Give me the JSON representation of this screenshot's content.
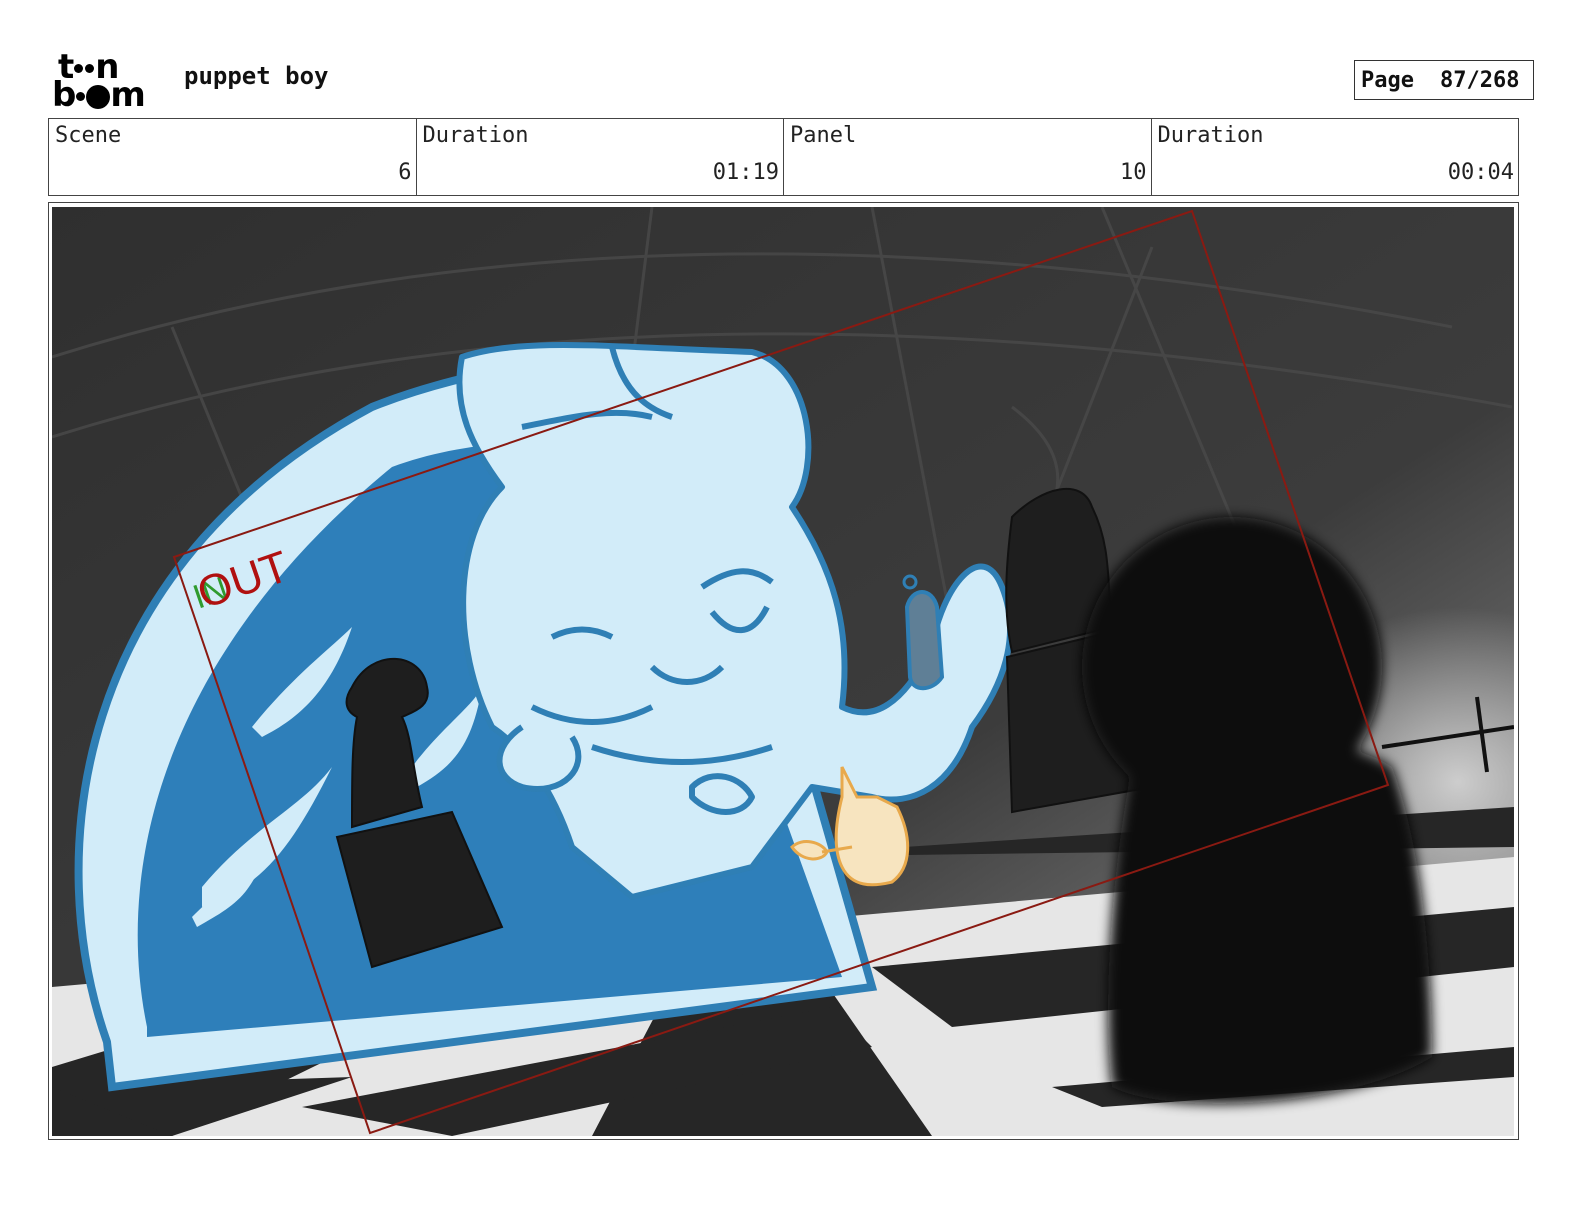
{
  "header": {
    "logo_text_top": "toon",
    "logo_text_bottom": "boom",
    "project_title": "puppet boy",
    "page_label": "Page",
    "page_value": "87/268"
  },
  "info": {
    "scene_label": "Scene",
    "scene_value": "6",
    "scene_duration_label": "Duration",
    "scene_duration_value": "01:19",
    "panel_label": "Panel",
    "panel_value": "10",
    "panel_duration_label": "Duration",
    "panel_duration_value": "00:04"
  },
  "panel": {
    "camera_label_in": "IN",
    "camera_label_out": "OUT",
    "colors": {
      "background": "#383838",
      "character_fill": "#d2ecf9",
      "character_line": "#2f7fb5",
      "window": "#2e7fba",
      "camera_frame": "#8a1a12",
      "small_figure": "#f5d6a0"
    }
  }
}
